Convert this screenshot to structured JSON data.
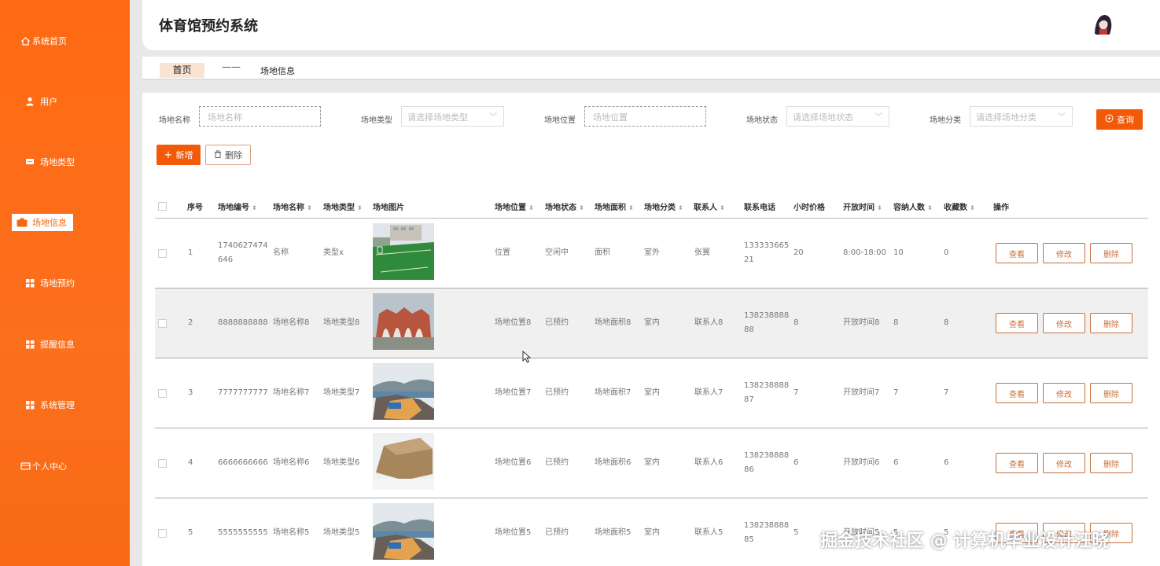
{
  "sidebar": {
    "items": [
      {
        "label": "系统首页",
        "icon": "home-icon"
      },
      {
        "label": "用户",
        "icon": "user-icon"
      },
      {
        "label": "场地类型",
        "icon": "chat-icon"
      },
      {
        "label": "场地信息",
        "icon": "briefcase-icon"
      },
      {
        "label": "场地预约",
        "icon": "grid-icon"
      },
      {
        "label": "提醒信息",
        "icon": "grid-icon"
      },
      {
        "label": "系统管理",
        "icon": "grid-icon"
      },
      {
        "label": "个人中心",
        "icon": "card-icon"
      }
    ]
  },
  "header": {
    "title": "体育馆预约系统"
  },
  "breadcrumb": {
    "home": "首页",
    "separator": "——",
    "current": "场地信息"
  },
  "filters": {
    "name_label": "场地名称",
    "name_placeholder": "场地名称",
    "type_label": "场地类型",
    "type_placeholder": "请选择场地类型",
    "location_label": "场地位置",
    "location_placeholder": "场地位置",
    "status_label": "场地状态",
    "status_placeholder": "请选择场地状态",
    "category_label": "场地分类",
    "category_placeholder": "请选择场地分类",
    "query_label": "查询"
  },
  "actions": {
    "add_label": "新增",
    "delete_label": "删除"
  },
  "table": {
    "headers": [
      "序号",
      "场地编号",
      "场地名称",
      "场地类型",
      "场地图片",
      "场地位置",
      "场地状态",
      "场地面积",
      "场地分类",
      "联系人",
      "联系电话",
      "小时价格",
      "开放时间",
      "容纳人数",
      "收藏数",
      "操作"
    ],
    "op_labels": {
      "view": "查看",
      "edit": "修改",
      "delete": "删除"
    },
    "rows": [
      {
        "idx": "1",
        "code": [
          "1740627474",
          "646"
        ],
        "name": "名称",
        "type": "类型x",
        "location": "位置",
        "status": "空闲中",
        "area": "面积",
        "category": "室外",
        "contact": "张翼",
        "phone": [
          "133333665",
          "21"
        ],
        "price": "20",
        "open": "8:00-18:00",
        "capacity": "10",
        "favorites": "0"
      },
      {
        "idx": "2",
        "code": [
          "8888888888"
        ],
        "name": "场地名称8",
        "type": "场地类型8",
        "location": "场地位置8",
        "status": "已预约",
        "area": "场地面积8",
        "category": "室内",
        "contact": "联系人8",
        "phone": [
          "138238888",
          "88"
        ],
        "price": "8",
        "open": "开放时间8",
        "capacity": "8",
        "favorites": "8"
      },
      {
        "idx": "3",
        "code": [
          "7777777777"
        ],
        "name": "场地名称7",
        "type": "场地类型7",
        "location": "场地位置7",
        "status": "已预约",
        "area": "场地面积7",
        "category": "室内",
        "contact": "联系人7",
        "phone": [
          "138238888",
          "87"
        ],
        "price": "7",
        "open": "开放时间7",
        "capacity": "7",
        "favorites": "7"
      },
      {
        "idx": "4",
        "code": [
          "6666666666"
        ],
        "name": "场地名称6",
        "type": "场地类型6",
        "location": "场地位置6",
        "status": "已预约",
        "area": "场地面积6",
        "category": "室内",
        "contact": "联系人6",
        "phone": [
          "138238888",
          "86"
        ],
        "price": "6",
        "open": "开放时间6",
        "capacity": "6",
        "favorites": "6"
      },
      {
        "idx": "5",
        "code": [
          "5555555555"
        ],
        "name": "场地名称5",
        "type": "场地类型5",
        "location": "场地位置5",
        "status": "已预约",
        "area": "场地面积5",
        "category": "室内",
        "contact": "联系人5",
        "phone": [
          "138238888",
          "85"
        ],
        "price": "5",
        "open": "开放时间5",
        "capacity": "5",
        "favorites": "5"
      }
    ]
  },
  "watermark": "掘金技术社区 @ 计算机毕业设计汪晓"
}
